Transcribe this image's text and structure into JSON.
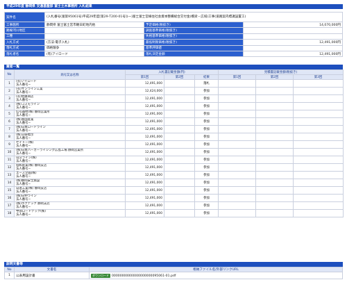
{
  "header": {
    "title": "平成29年度 静岡県 交通基盤部 富士土木事務所 入札結果"
  },
  "info": {
    "rows": [
      {
        "l1": "案件名",
        "v1": "(入札番号(富第95061号)平成29年度[第29-T200-01号](一)富士富士宮線住社会資本整備総合交付金(橋梁・広域)工事(道路案内標識設置工)",
        "l2": "",
        "v2": ""
      },
      {
        "l1": "工事箇所",
        "v1": "静岡県 富士富士宮市朝日町地内他",
        "l2": "予定価格(税抜き)",
        "v2": "14,070,000円"
      },
      {
        "l1": "路線河川地区",
        "v1": "",
        "l2": "調査基準価格(税抜き)",
        "v2": ""
      },
      {
        "l1": "工種",
        "v1": "",
        "l2": "失格基準価格(税抜き)",
        "v2": ""
      },
      {
        "l1": "入札方式",
        "v1": "(方法:電子入札)",
        "l2": "最低制限価格(税抜き)",
        "v2": "12,491,000円"
      },
      {
        "l1": "落札方式",
        "v1": "価格競争",
        "l2": "基準評価値",
        "v2": ""
      },
      {
        "l1": "落札者名",
        "v1": "(有)アイロード",
        "l2": "落札決定金額",
        "v2": "12,491,000円"
      }
    ]
  },
  "list": {
    "title": "業者一覧",
    "headers": {
      "no": "No",
      "name": "商号又は名称",
      "bid": "入札書記載金額(円)",
      "second": "見積書記載金額(税抜き)",
      "r1": "第1回",
      "r2": "第2回",
      "result": "結果",
      "s1": "第1回",
      "s2": "第2回",
      "s3": "第3回"
    },
    "rows": [
      {
        "no": "1",
        "name": "(有)アイロード",
        "sub": "法人番号−",
        "amt": "12,491,000",
        "res": "落札"
      },
      {
        "no": "2",
        "name": "(有)サンライン工業",
        "sub": "法人番号−",
        "amt": "12,424,000",
        "res": "参加"
      },
      {
        "no": "3",
        "name": "(有)佐藤商店",
        "sub": "法人番号−",
        "amt": "12,491,000",
        "res": "参加"
      },
      {
        "no": "4",
        "name": "(株)コスモライン",
        "sub": "法人番号−",
        "amt": "12,491,000",
        "res": "参加"
      },
      {
        "no": "5",
        "name": "信号器材(株) 静岡営業所",
        "sub": "法人番号−",
        "amt": "12,491,000",
        "res": "参加"
      },
      {
        "no": "6",
        "name": "(株)富国産業",
        "sub": "法人番号−",
        "amt": "12,491,000",
        "res": "参加"
      },
      {
        "no": "7",
        "name": "(株)日本ロードライン",
        "sub": "法人番号−",
        "amt": "12,491,000",
        "res": "参加"
      },
      {
        "no": "8",
        "name": "(株)交研標示",
        "sub": "法人番号−",
        "amt": "12,491,000",
        "res": "参加"
      },
      {
        "no": "9",
        "name": "セイトー(株)",
        "sub": "法人番号−",
        "amt": "12,491,000",
        "res": "参加"
      },
      {
        "no": "10",
        "name": "(株)日本パーカーライジング広島工場 静岡営業所",
        "sub": "法人番号−",
        "amt": "12,491,000",
        "res": "参加"
      },
      {
        "no": "11",
        "name": "山交ライン(株)",
        "sub": "法人番号−",
        "amt": "12,491,000",
        "res": "参加"
      },
      {
        "no": "12",
        "name": "協和産業(株) 静岡支店",
        "sub": "法人番号−",
        "amt": "12,491,000",
        "res": "参加"
      },
      {
        "no": "13",
        "name": "エース企画(株)",
        "sub": "法人番号−",
        "amt": "12,491,000",
        "res": "参加"
      },
      {
        "no": "14",
        "name": "(株)静岡安全施設",
        "sub": "法人番号−",
        "amt": "12,491,000",
        "res": "参加"
      },
      {
        "no": "15",
        "name": "日進工業(株) 静岡支店",
        "sub": "法人番号−",
        "amt": "12,491,000",
        "res": "参加"
      },
      {
        "no": "16",
        "name": "(株)日伸ライン",
        "sub": "法人番号−",
        "amt": "12,491,000",
        "res": "参加"
      },
      {
        "no": "17",
        "name": "(株)ホクテック 静岡支店",
        "sub": "法人番号−",
        "amt": "12,491,000",
        "res": "参加"
      },
      {
        "no": "18",
        "name": "中部ロードテック(株)",
        "sub": "法人番号−",
        "amt": "12,491,000",
        "res": "参加"
      }
    ]
  },
  "docs": {
    "title": "説明文書等",
    "headers": {
      "no": "No",
      "name": "文書名",
      "file": "格納ファイル名/外部リンクURL"
    },
    "rows": [
      {
        "no": "1",
        "name": "公表用設計書",
        "btn": "ダウンロード",
        "file": "00000000000000000000095061-01.pdf"
      }
    ]
  }
}
